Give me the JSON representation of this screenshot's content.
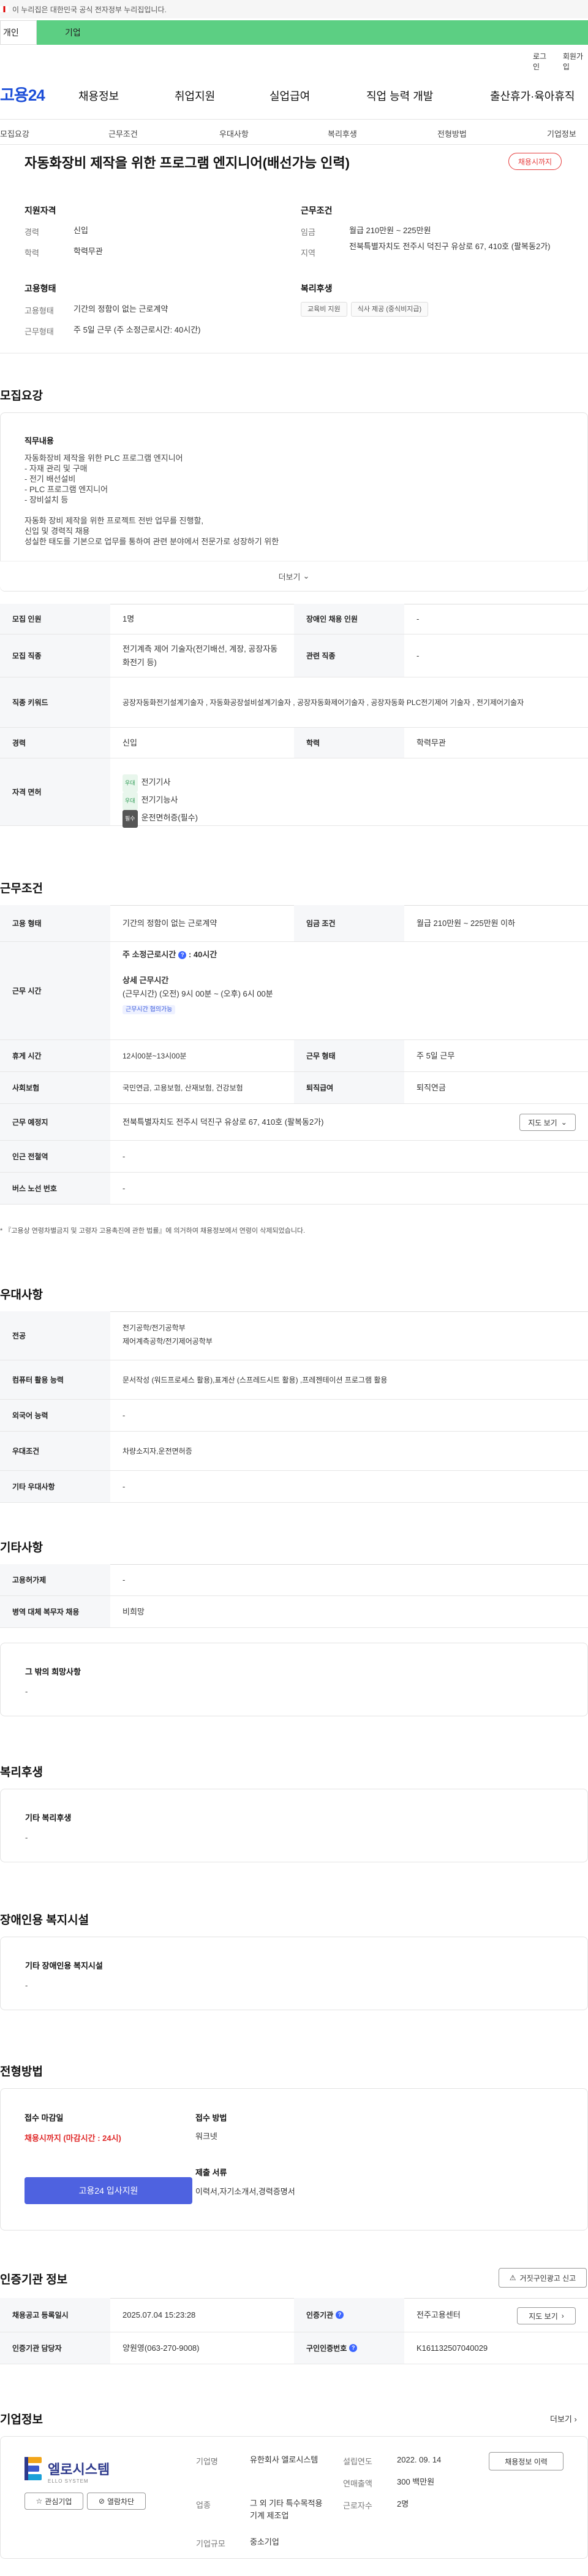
{
  "gov_banner": "이 누리집은 대한민국 공식 전자정부 누리집입니다.",
  "type_tabs": [
    "개인",
    "기업"
  ],
  "util": [
    "로그인",
    "회원가입"
  ],
  "gnb": {
    "logo": "고용24",
    "items": [
      "채용정보",
      "취업지원",
      "실업급여",
      "직업 능력 개발",
      "출산휴가·육아휴직"
    ]
  },
  "tabs": [
    "모집요강",
    "근무조건",
    "우대사항",
    "복리후생",
    "전형방법",
    "기업정보"
  ],
  "job": {
    "title": "자동화장비 제작을 위한 프로그램 엔지니어(배선가능 인력)",
    "badge": "채용시까지",
    "qual_title": "지원자격",
    "career_k": "경력",
    "career_v": "신입",
    "edu_k": "학력",
    "edu_v": "학력무관",
    "cond_title": "근무조건",
    "wage_k": "임금",
    "wage_v": "월급 210만원 ~ 225만원",
    "loc_k": "지역",
    "loc_v": "전북특별자치도 전주시 덕진구 유상로 67, 410호 (팔복동2가)",
    "emp_title": "고용형태",
    "emp_type_k": "고용형태",
    "emp_type_v": "기간의 정함이 없는 근로계약",
    "work_k": "근무형태",
    "work_v": "주 5일 근무 (주 소정근로시간: 40시간)",
    "welfare_title": "복리후생",
    "welfare_chips": [
      "교육비 지원",
      "식사 제공 (중식비지급)"
    ]
  },
  "recruit": {
    "heading": "모집요강",
    "duty_title": "직무내용",
    "duty_lines": [
      "자동화장비 제작을 위한 PLC 프로그램 엔지니어",
      "- 자재 관리 및 구매",
      "- 전기 배선설비",
      "- PLC 프로그램 엔지니어",
      "- 장비설치 등",
      "",
      "자동화 장비 제작을 위한 프로젝트 전반 업무를 진행할,",
      "신입 및 경력직 채용",
      "성실한 태도를 기본으로 업무를 통하여 관련 분야에서 전문가로 성장하기 위한"
    ],
    "more": "더보기",
    "rows": {
      "count_k": "모집 인원",
      "count_v": "1명",
      "dis_k": "장애인 채용 인원",
      "dis_v": "-",
      "job_k": "모집 직종",
      "job_v": "전기계측 제어 기술자(전기배선, 계장, 공장자동화전기 등)",
      "rel_k": "관련 직종",
      "rel_v": "-",
      "kw_k": "직종 키워드",
      "kw_v": "공장자동화전기설계기술자 , 자동화공장설비설계기술자 , 공장자동화제어기술자 , 공장자동화 PLC전기제어 기술자 , 전기제어기술자",
      "career_k": "경력",
      "career_v": "신입",
      "edu_k": "학력",
      "edu_v": "학력무관",
      "lic_k": "자격 면허",
      "licenses": [
        {
          "tag": "우대",
          "name": "전기기사"
        },
        {
          "tag": "우대",
          "name": "전기기능사"
        },
        {
          "tag": "필수",
          "name": "운전면허증(필수)"
        }
      ]
    }
  },
  "work": {
    "heading": "근무조건",
    "emp_k": "고용 형태",
    "emp_v": "기간의 정함이 없는 근로계약",
    "wage_k": "임금 조건",
    "wage_v": "월급 210만원 ~ 225만원 이하",
    "time_k": "근무 시간",
    "weekly": "주 소정근로시간",
    "weekly_v": "40시간",
    "detail_title": "상세 근무시간",
    "detail_v": "(근무시간) (오전) 9시 00분 ~ (오후) 6시 00분",
    "flex": "근무시간 협의가능",
    "rest_k": "휴게 시간",
    "rest_v": "12시00분~13시00분",
    "type_k": "근무 형태",
    "type_v": "주 5일 근무",
    "ins_k": "사회보험",
    "ins_v": "국민연금, 고용보험, 산재보험, 건강보험",
    "ret_k": "퇴직급여",
    "ret_v": "퇴직연금",
    "place_k": "근무 예정지",
    "place_v": "전북특별자치도 전주시 덕진구 유상로 67, 410호 (팔복동2가)",
    "map_btn": "지도 보기",
    "sub_k": "인근 전철역",
    "sub_v": "-",
    "bus_k": "버스 노선 번호",
    "bus_v": "-",
    "note": "* 『고용상 연령차별금지 및 고령자 고용촉진에 관한 법률』에 의거하여 채용정보에서 연령이 삭제되었습니다."
  },
  "pref": {
    "heading": "우대사항",
    "major_k": "전공",
    "major_v1": "전기공학/전기공학부",
    "major_v2": "제어계측공학/전기제어공학부",
    "pc_k": "컴퓨터 활용 능력",
    "pc_v": "문서작성 (워드프로세스 활용),표계산 (스프레드시트 활용) ,프레젠테이션 프로그램 활용",
    "lang_k": "외국어 능력",
    "lang_v": "-",
    "cond_k": "우대조건",
    "cond_v": "차량소지자,운전면허증",
    "etc_k": "기타 우대사항",
    "etc_v": "-"
  },
  "other": {
    "heading": "기타사항",
    "type_k": "고용허가제",
    "type_v": "-",
    "mil_k": "병역 대체 복무자 채용",
    "mil_v": "비희망",
    "wish_title": "그 밖의 희망사항",
    "wish_v": "-"
  },
  "welfare": {
    "heading": "복리후생",
    "title": "기타 복리후생",
    "v": "-"
  },
  "dis": {
    "heading": "장애인용 복지시설",
    "title": "기타 장애인용 복지시설",
    "v": "-"
  },
  "select": {
    "heading": "전형방법",
    "deadline_t": "접수 마감일",
    "deadline_v": "채용시까지 (마감시간 : 24시)",
    "apply_btn": "고용24 입사지원",
    "method_t": "접수 방법",
    "method_v": "워크넷",
    "docs_t": "제출 서류",
    "docs_v": "이력서,자기소개서,경력증명서"
  },
  "cert": {
    "heading": "인증기관 정보",
    "report_btn": "거짓구인광고 신고",
    "reg_k": "채용공고 등록일시",
    "reg_v": "2025.07.04 15:23:28",
    "org_k": "인증기관",
    "org_v": "전주고용센터",
    "map_btn": "지도 보기",
    "mgr_k": "인증기관 담당자",
    "mgr_v": "양원영(063-270-9008)",
    "no_k": "구인인증번호",
    "no_v": "K161132507040029"
  },
  "company": {
    "heading": "기업정보",
    "more": "더보기",
    "logo_main": "엘로시스템",
    "logo_sub": "ELLO SYSTEM",
    "fav": "관심기업",
    "block": "열람차단",
    "name_k": "기업명",
    "name_v": "유한회사 엘로시스템",
    "ind_k": "업종",
    "ind_v": "그 외 기타 특수목적용 기계 제조업",
    "size_k": "기업규모",
    "size_v": "중소기업",
    "est_k": "설립연도",
    "est_v": "2022. 09. 14",
    "sales_k": "연매출액",
    "sales_v": "300 백만원",
    "emp_k": "근로자수",
    "emp_v": "2명",
    "jobs_btn": "채용정보 이력"
  }
}
